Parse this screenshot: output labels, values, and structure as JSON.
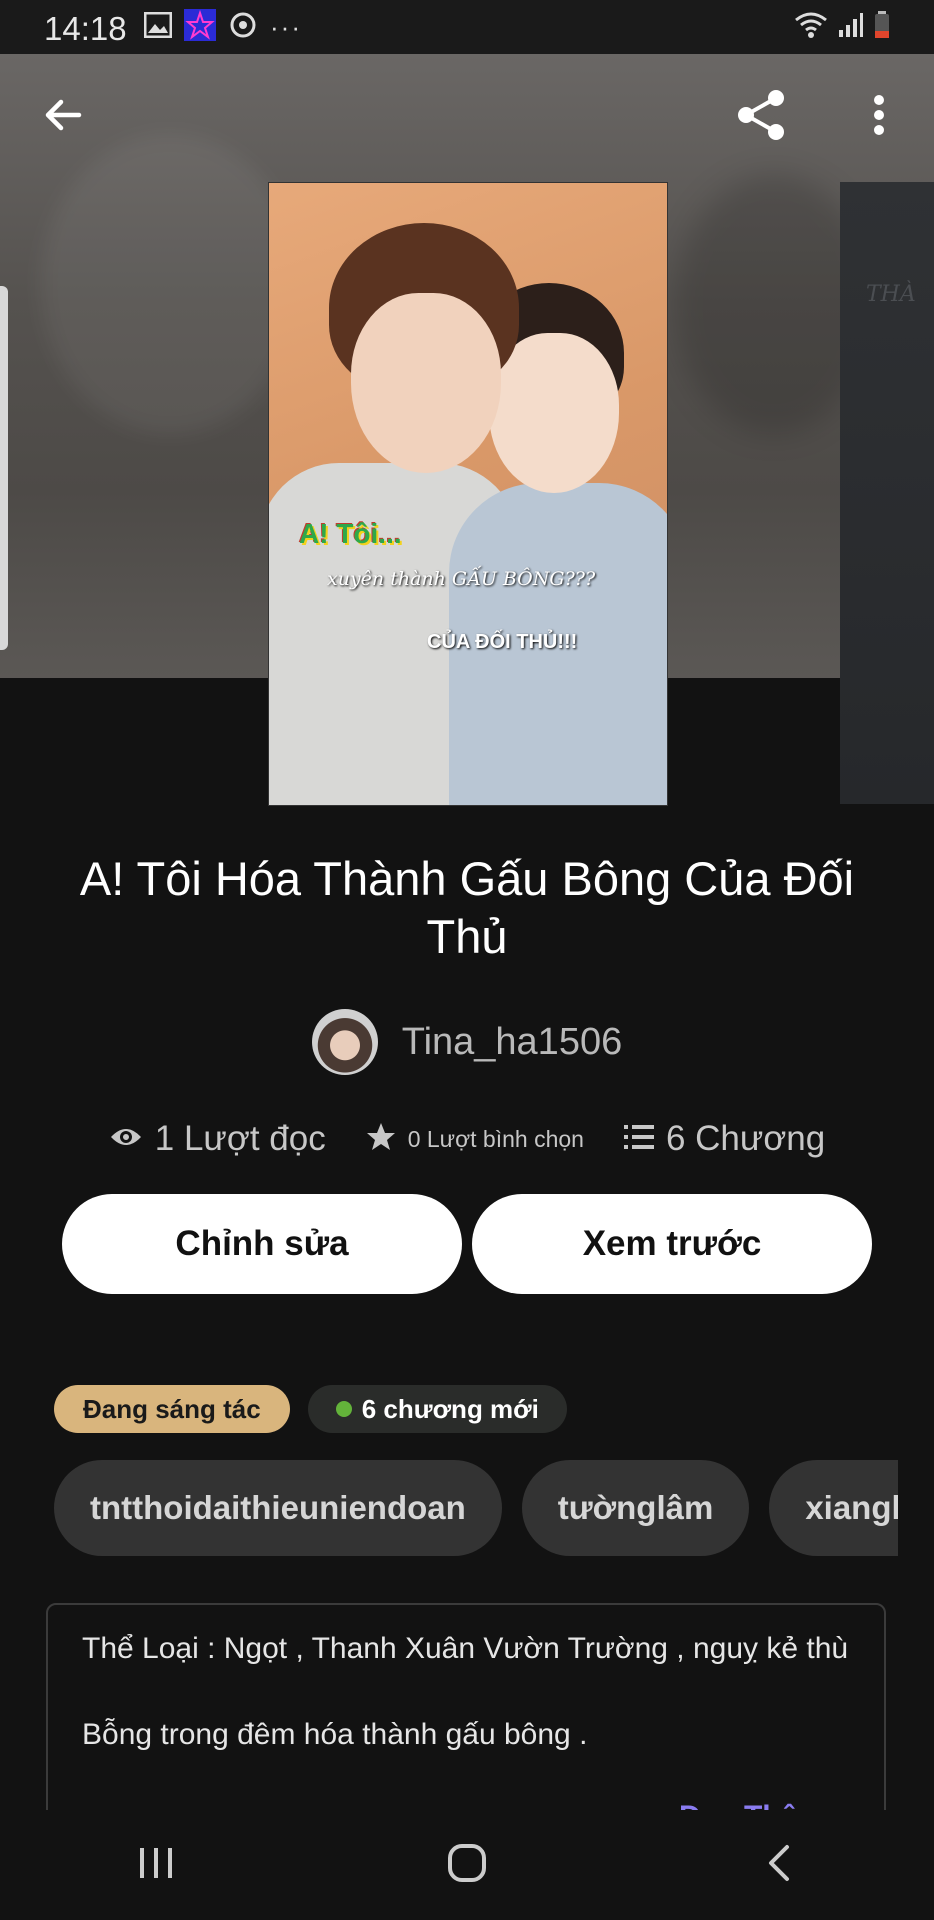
{
  "status_bar": {
    "time": "14:18",
    "more_label": "···",
    "left_icons": [
      "image-icon",
      "star-app-icon",
      "sync-icon",
      "more-dots-icon"
    ],
    "right_icons": [
      "wifi-icon",
      "signal-icon",
      "battery-low-icon"
    ]
  },
  "top_bar": {
    "back_icon": "arrow-left-icon",
    "share_icon": "share-icon",
    "menu_icon": "kebab-menu-icon"
  },
  "cover": {
    "text_line1": "A! Tôi...",
    "text_line2": "xuyên thành GẤU BÔNG???",
    "text_line3": "CỦA ĐỐI THỦ!!!",
    "next_cover_text": "THÀ"
  },
  "story": {
    "title": "A! Tôi Hóa Thành Gấu Bông Của Đối Thủ",
    "author": "Tina_ha1506",
    "reads": "1 Lượt đọc",
    "votes": "0 Lượt bình chọn",
    "chapters": "6 Chương"
  },
  "actions": {
    "edit_label": "Chỉnh sửa",
    "preview_label": "Xem trước"
  },
  "badges": {
    "status": "Đang sáng tác",
    "new_chapters": "6 chương mới"
  },
  "tags": [
    "tntthoidaithieuniendoan",
    "tườnglâm",
    "xianglin"
  ],
  "description": {
    "line1": "Thể Loại : Ngọt , Thanh Xuân Vườn Trường  , nguỵ kẻ thù",
    "line2": "Bỗng trong đêm hóa thành gấu bông .",
    "more_label": "Đọc Thêm"
  },
  "colors": {
    "background": "#121212",
    "status_badge": "#d9b57d",
    "new_dot": "#63b33a",
    "link": "#8a7cf0"
  },
  "nav_bar": {
    "icons": [
      "recent-apps-icon",
      "home-icon",
      "back-chevron-icon"
    ]
  }
}
